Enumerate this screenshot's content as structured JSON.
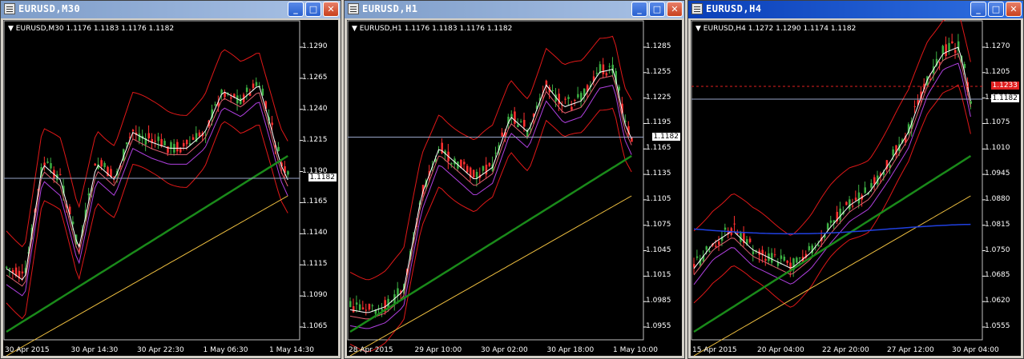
{
  "windows": [
    {
      "title": "EURUSD,M30",
      "header": "EURUSD,M30  1.1176 1.1183 1.1176 1.1182",
      "prices": [
        "1.1290",
        "1.1265",
        "1.1240",
        "1.1215",
        "1.1190",
        "1.1165",
        "1.1140",
        "1.1115",
        "1.1090",
        "1.1065"
      ],
      "current": "1.1182",
      "times": [
        "30 Apr 2015",
        "30 Apr 14:30",
        "30 Apr 22:30",
        "1 May 06:30",
        "1 May 14:30"
      ],
      "controls": {
        "minimize": "_",
        "maximize": "□",
        "close": "✕"
      }
    },
    {
      "title": "EURUSD,H1",
      "header": "EURUSD,H1  1.1176 1.1183 1.1176 1.1182",
      "prices": [
        "1.1285",
        "1.1255",
        "1.1225",
        "1.1195",
        "1.1165",
        "1.1135",
        "1.1105",
        "1.1075",
        "1.1045",
        "1.1015",
        "1.0985",
        "1.0955"
      ],
      "current": "1.1182",
      "times": [
        "28 Apr 2015",
        "29 Apr 10:00",
        "30 Apr 02:00",
        "30 Apr 18:00",
        "1 May 10:00"
      ],
      "controls": {
        "minimize": "_",
        "maximize": "□",
        "close": "✕"
      }
    },
    {
      "title": "EURUSD,H4",
      "header": "EURUSD,H4  1.1272 1.1290 1.1174 1.1182",
      "prices": [
        "1.1270",
        "1.1205",
        "1.1140",
        "1.1075",
        "1.1010",
        "1.0945",
        "1.0880",
        "1.0815",
        "1.0750",
        "1.0685",
        "1.0620",
        "1.0555"
      ],
      "current": "1.1182",
      "order": "1.1233",
      "times": [
        "15 Apr 2015",
        "20 Apr 04:00",
        "22 Apr 20:00",
        "27 Apr 12:00",
        "30 Apr 04:00"
      ],
      "controls": {
        "minimize": "_",
        "maximize": "□",
        "close": "✕"
      }
    }
  ],
  "colors": {
    "bull": "#ff3030",
    "bear": "#3cb043",
    "bollinger": "#e01818",
    "ma_fast": "#ffffff",
    "ma_mid": "#e06070",
    "ma_slow": "#b040e0",
    "ma_trend": "#1a8a1a",
    "ma_long": "#f0c040",
    "ma_blue": "#2040e0"
  }
}
